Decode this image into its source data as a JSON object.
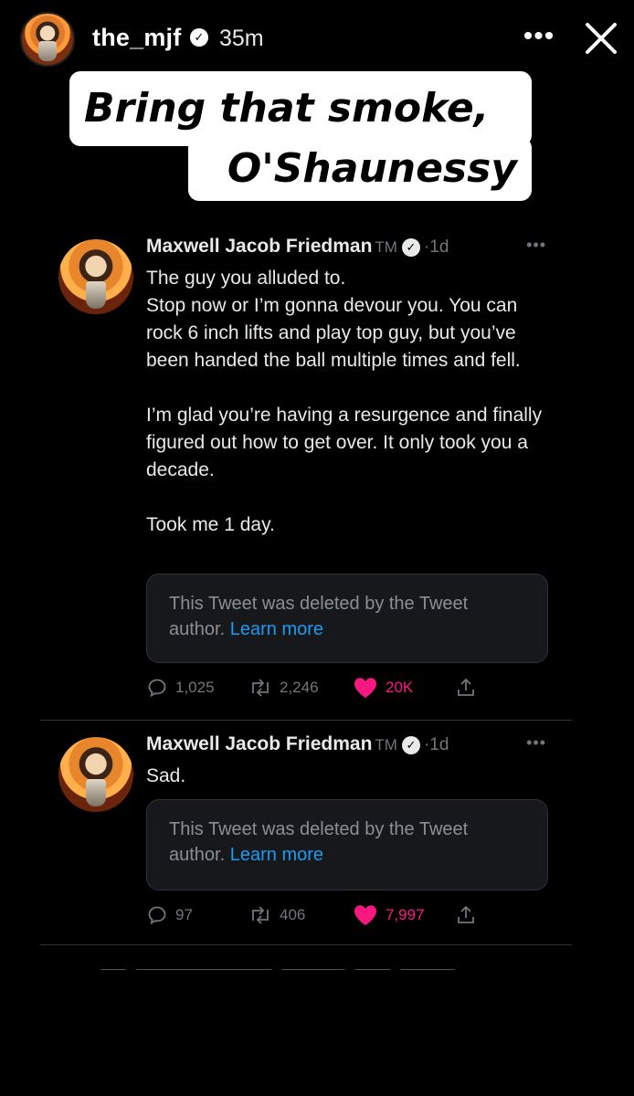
{
  "story": {
    "username": "the_mjf",
    "time": "35m",
    "more_label": "•••",
    "caption_line1": "Bring that smoke,",
    "caption_line2": "O'Shaunessy"
  },
  "tweets": [
    {
      "name": "Maxwell Jacob Friedman",
      "tm": "TM",
      "time": "1d",
      "more": "•••",
      "paragraphs": [
        "The guy you alluded to.\nStop now or I’m gonna devour you. You can rock 6 inch lifts and play top guy, but you’ve been handed the ball multiple times and fell.",
        "I’m glad you’re having a resurgence and finally figured out how to get over. It only took you a decade.",
        "Took me 1 day."
      ],
      "deleted_text": "This Tweet was deleted by the Tweet author.",
      "learn_more": "Learn more",
      "replies": "1,025",
      "retweets": "2,246",
      "likes": "20K"
    },
    {
      "name": "Maxwell Jacob Friedman",
      "tm": "TM",
      "time": "1d",
      "more": "•••",
      "paragraphs": [
        "Sad."
      ],
      "deleted_text": "This Tweet was deleted by the Tweet author.",
      "learn_more": "Learn more",
      "replies": "97",
      "retweets": "406",
      "likes": "7,997"
    }
  ],
  "colors": {
    "background": "#000000",
    "like_active": "#f91880",
    "link": "#1d9bf0",
    "secondary_text": "#71767b"
  },
  "icons": [
    "verified-badge-icon",
    "more-icon",
    "close-icon",
    "reply-icon",
    "retweet-icon",
    "like-icon",
    "share-icon"
  ]
}
